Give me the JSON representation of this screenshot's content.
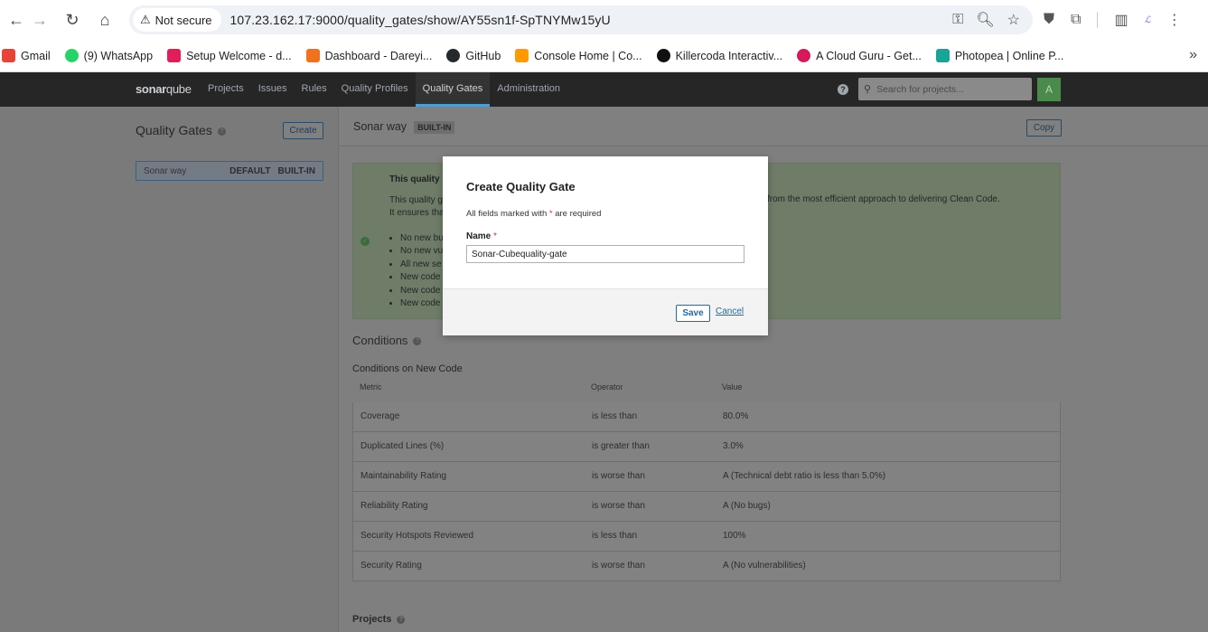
{
  "browser": {
    "security_label": "Not secure",
    "url": "107.23.162.17:9000/quality_gates/show/AY55sn1f-SpTNYMw15yU",
    "bookmarks": [
      {
        "label": "Gmail",
        "icon": "gmail-icon",
        "color": "#ea4335"
      },
      {
        "label": "(9) WhatsApp",
        "icon": "whatsapp-icon",
        "color": "#25d366"
      },
      {
        "label": "Setup Welcome - d...",
        "icon": "slack-icon",
        "color": "#e01e5a"
      },
      {
        "label": "Dashboard - Dareyi...",
        "icon": "darey-icon",
        "color": "#f2711c"
      },
      {
        "label": "GitHub",
        "icon": "github-icon",
        "color": "#24292e"
      },
      {
        "label": "Console Home | Co...",
        "icon": "aws-icon",
        "color": "#ff9900"
      },
      {
        "label": "Killercoda Interactiv...",
        "icon": "killercoda-icon",
        "color": "#111111"
      },
      {
        "label": "A Cloud Guru - Get...",
        "icon": "acloudguru-icon",
        "color": "#d6195b"
      },
      {
        "label": "Photopea | Online P...",
        "icon": "photopea-icon",
        "color": "#18a497"
      }
    ]
  },
  "sonar": {
    "logo": {
      "bold": "sonar",
      "rest": "qube"
    },
    "menu": [
      "Projects",
      "Issues",
      "Rules",
      "Quality Profiles",
      "Quality Gates",
      "Administration"
    ],
    "active_menu": "Quality Gates",
    "search_placeholder": "Search for projects...",
    "avatar": "A"
  },
  "left": {
    "title": "Quality Gates",
    "create_label": "Create",
    "gates": [
      {
        "name": "Sonar way",
        "tags": [
          "DEFAULT",
          "BUILT-IN"
        ]
      }
    ]
  },
  "gate": {
    "name": "Sonar way",
    "badge": "BUILT-IN",
    "copy_label": "Copy",
    "info_title": "This quality",
    "info_line1": "This quality g",
    "info_line1_right": "from the most efficient approach to delivering Clean Code.",
    "info_line2": "It ensures tha",
    "info_items": [
      "No new bu",
      "No new vu",
      "All new se",
      "New code",
      "New code",
      "New code"
    ]
  },
  "conditions": {
    "title": "Conditions",
    "subtitle": "Conditions on New Code",
    "headers": {
      "metric": "Metric",
      "operator": "Operator",
      "value": "Value"
    },
    "rows": [
      {
        "metric": "Coverage",
        "operator": "is less than",
        "value": "80.0%"
      },
      {
        "metric": "Duplicated Lines (%)",
        "operator": "is greater than",
        "value": "3.0%"
      },
      {
        "metric": "Maintainability Rating",
        "operator": "is worse than",
        "value": "A  (Technical debt ratio is less than 5.0%)"
      },
      {
        "metric": "Reliability Rating",
        "operator": "is worse than",
        "value": "A  (No bugs)"
      },
      {
        "metric": "Security Hotspots Reviewed",
        "operator": "is less than",
        "value": "100%"
      },
      {
        "metric": "Security Rating",
        "operator": "is worse than",
        "value": "A  (No vulnerabilities)"
      }
    ]
  },
  "projects": {
    "title": "Projects"
  },
  "modal": {
    "title": "Create Quality Gate",
    "note_prefix": "All fields marked with ",
    "note_star": "*",
    "note_suffix": " are required",
    "name_label": "Name",
    "name_star": "*",
    "name_value": "Sonar-Cubequality-gate",
    "save_label": "Save",
    "cancel_label": "Cancel"
  }
}
